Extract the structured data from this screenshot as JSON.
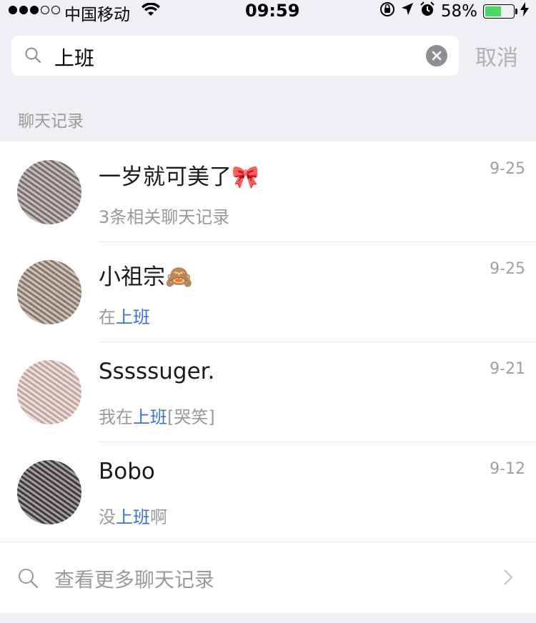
{
  "status_bar": {
    "carrier": "中国移动",
    "time": "09:59",
    "battery_percent": "58%",
    "battery_level": 0.58
  },
  "search": {
    "query": "上班",
    "cancel_label": "取消"
  },
  "section": {
    "header": "聊天记录"
  },
  "results": [
    {
      "title_text": "一岁就可美了",
      "title_emoji": "🎀",
      "subtitle_pre": "3条相关聊天记录",
      "subtitle_hl": "",
      "subtitle_post": "",
      "date": "9-25"
    },
    {
      "title_text": "小祖宗",
      "title_emoji": "🙈",
      "subtitle_pre": "在",
      "subtitle_hl": "上班",
      "subtitle_post": "",
      "date": "9-25"
    },
    {
      "title_text": "Sssssuger.",
      "title_emoji": "",
      "subtitle_pre": "我在",
      "subtitle_hl": "上班",
      "subtitle_post": "[哭笑]",
      "date": "9-21"
    },
    {
      "title_text": "Bobo",
      "title_emoji": "",
      "subtitle_pre": "没",
      "subtitle_hl": "上班",
      "subtitle_post": "啊",
      "date": "9-12"
    }
  ],
  "more": {
    "label": "查看更多聊天记录"
  },
  "colors": {
    "highlight": "#3a6fd8",
    "battery": "#4cd964"
  }
}
